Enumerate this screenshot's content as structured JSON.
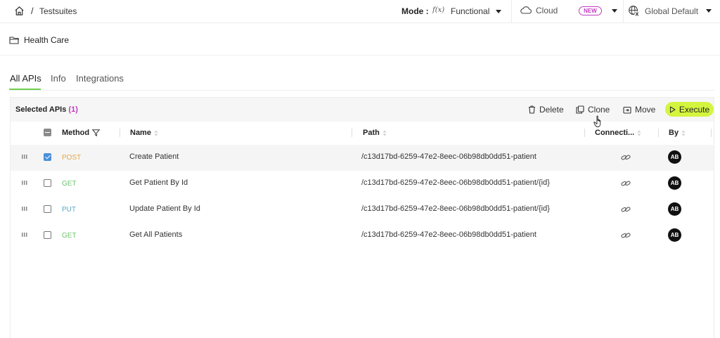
{
  "topbar": {
    "breadcrumb_sep": "/",
    "breadcrumb": "Testsuites",
    "mode_label": "Mode :",
    "mode_icon": "f(x)",
    "mode_value": "Functional",
    "cloud_label": "Cloud",
    "new_badge": "NEW",
    "region_label": "Global Default"
  },
  "suite": {
    "title": "Health Care"
  },
  "tabs": [
    {
      "label": "All APIs",
      "active": true
    },
    {
      "label": "Info",
      "active": false
    },
    {
      "label": "Integrations",
      "active": false
    }
  ],
  "panel": {
    "selected_label": "Selected APIs",
    "selected_count": "(1)",
    "actions": {
      "delete": "Delete",
      "clone": "Clone",
      "move": "Move",
      "execute": "Execute"
    }
  },
  "columns": {
    "method": "Method",
    "name": "Name",
    "path": "Path",
    "connections": "Connecti...",
    "by": "By"
  },
  "rows": [
    {
      "method": "POST",
      "name": "Create Patient",
      "path": "/c13d17bd-6259-47e2-8eec-06b98db0dd51-patient",
      "by": "AB",
      "selected": true
    },
    {
      "method": "GET",
      "name": "Get Patient By Id",
      "path": "/c13d17bd-6259-47e2-8eec-06b98db0dd51-patient/{id}",
      "by": "AB",
      "selected": false
    },
    {
      "method": "PUT",
      "name": "Update Patient By Id",
      "path": "/c13d17bd-6259-47e2-8eec-06b98db0dd51-patient/{id}",
      "by": "AB",
      "selected": false
    },
    {
      "method": "GET",
      "name": "Get All Patients",
      "path": "/c13d17bd-6259-47e2-8eec-06b98db0dd51-patient",
      "by": "AB",
      "selected": false
    }
  ],
  "colors": {
    "post": "#e5a84a",
    "get": "#6cc46c",
    "put": "#5aa7c9",
    "accent": "#d4f53e",
    "badge": "#c03ac0",
    "tab_underline": "#6fd04f"
  }
}
